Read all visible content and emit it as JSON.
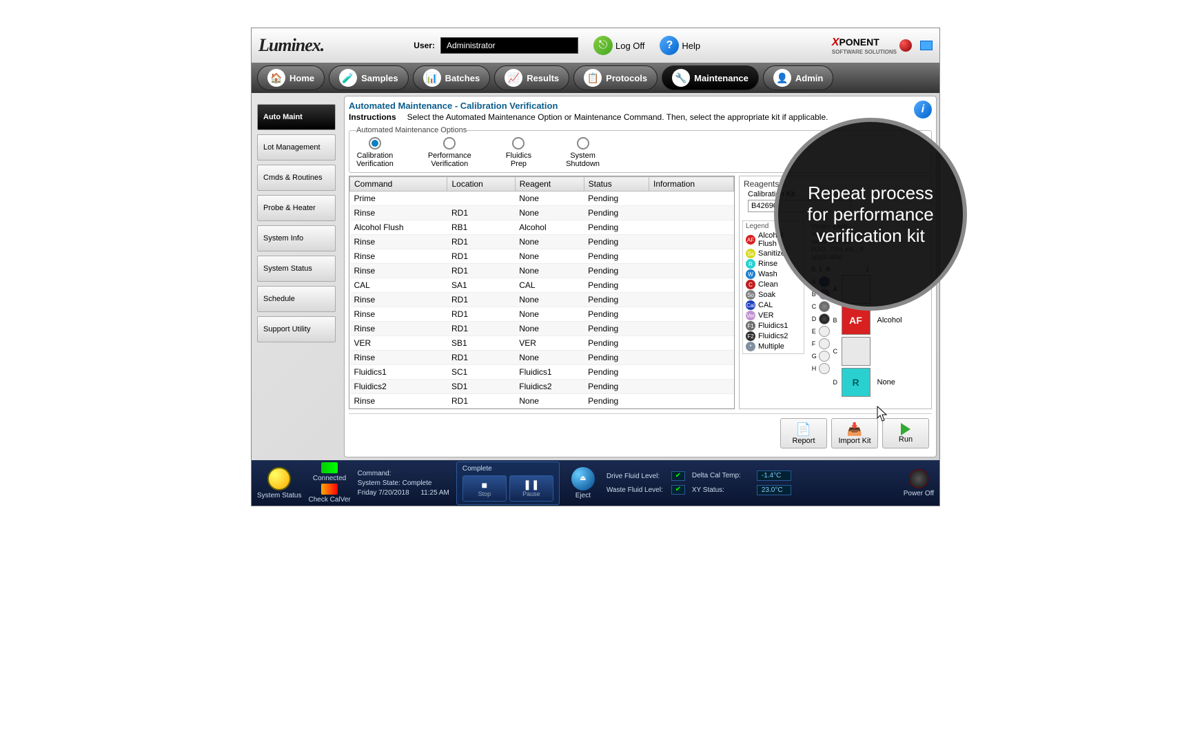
{
  "header": {
    "logo": "Luminex.",
    "user_label": "User:",
    "user_value": "Administrator",
    "logoff": "Log Off",
    "help": "Help",
    "brand_prefix": "X",
    "brand_rest": "PONENT",
    "brand_sub": "SOFTWARE SOLUTIONS"
  },
  "tabs": [
    {
      "label": "Home",
      "icon": "🏠"
    },
    {
      "label": "Samples",
      "icon": "🧪"
    },
    {
      "label": "Batches",
      "icon": "📊"
    },
    {
      "label": "Results",
      "icon": "📈"
    },
    {
      "label": "Protocols",
      "icon": "📋"
    },
    {
      "label": "Maintenance",
      "icon": "🔧",
      "active": true
    },
    {
      "label": "Admin",
      "icon": "👤"
    }
  ],
  "sidebar": [
    {
      "label": "Auto Maint",
      "active": true
    },
    {
      "label": "Lot Management"
    },
    {
      "label": "Cmds & Routines"
    },
    {
      "label": "Probe & Heater"
    },
    {
      "label": "System Info"
    },
    {
      "label": "System Status"
    },
    {
      "label": "Schedule"
    },
    {
      "label": "Support Utility"
    }
  ],
  "panel": {
    "title": "Automated Maintenance - Calibration Verification",
    "instructions_label": "Instructions",
    "instructions_text": "Select the Automated Maintenance Option or Maintenance Command. Then, select the appropriate kit if applicable.",
    "options_legend": "Automated Maintenance Options",
    "options": [
      {
        "label": "Calibration Verification",
        "selected": true
      },
      {
        "label": "Performance Verification"
      },
      {
        "label": "Fluidics Prep"
      },
      {
        "label": "System Shutdown"
      }
    ]
  },
  "table": {
    "headers": [
      "Command",
      "Location",
      "Reagent",
      "Status",
      "Information"
    ],
    "rows": [
      {
        "c": "Prime",
        "l": "",
        "r": "None",
        "s": "Pending",
        "i": ""
      },
      {
        "c": "Rinse",
        "l": "RD1",
        "r": "None",
        "s": "Pending",
        "i": ""
      },
      {
        "c": "Alcohol Flush",
        "l": "RB1",
        "r": "Alcohol",
        "s": "Pending",
        "i": ""
      },
      {
        "c": "Rinse",
        "l": "RD1",
        "r": "None",
        "s": "Pending",
        "i": ""
      },
      {
        "c": "Rinse",
        "l": "RD1",
        "r": "None",
        "s": "Pending",
        "i": ""
      },
      {
        "c": "Rinse",
        "l": "RD1",
        "r": "None",
        "s": "Pending",
        "i": ""
      },
      {
        "c": "CAL",
        "l": "SA1",
        "r": "CAL",
        "s": "Pending",
        "i": ""
      },
      {
        "c": "Rinse",
        "l": "RD1",
        "r": "None",
        "s": "Pending",
        "i": ""
      },
      {
        "c": "Rinse",
        "l": "RD1",
        "r": "None",
        "s": "Pending",
        "i": ""
      },
      {
        "c": "Rinse",
        "l": "RD1",
        "r": "None",
        "s": "Pending",
        "i": ""
      },
      {
        "c": "VER",
        "l": "SB1",
        "r": "VER",
        "s": "Pending",
        "i": ""
      },
      {
        "c": "Rinse",
        "l": "RD1",
        "r": "None",
        "s": "Pending",
        "i": ""
      },
      {
        "c": "Fluidics1",
        "l": "SC1",
        "r": "Fluidics1",
        "s": "Pending",
        "i": ""
      },
      {
        "c": "Fluidics2",
        "l": "SD1",
        "r": "Fluidics2",
        "s": "Pending",
        "i": ""
      },
      {
        "c": "Rinse",
        "l": "RD1",
        "r": "None",
        "s": "Pending",
        "i": ""
      }
    ]
  },
  "reagents": {
    "title": "Reagents",
    "kit_label": "Calibration Kit",
    "kit_value": "B42690",
    "legend_title": "Legend",
    "legend": [
      {
        "code": "AF",
        "label": "Alcohol Flush",
        "color": "#d82020"
      },
      {
        "code": "Sa",
        "label": "Sanitize",
        "color": "#d8d820"
      },
      {
        "code": "R",
        "label": "Rinse",
        "color": "#2ad0d0"
      },
      {
        "code": "W",
        "label": "Wash",
        "color": "#2080d0"
      },
      {
        "code": "C",
        "label": "Clean",
        "color": "#c02020"
      },
      {
        "code": "So",
        "label": "Soak",
        "color": "#808080"
      },
      {
        "code": "Cal",
        "label": "CAL",
        "color": "#2040c0"
      },
      {
        "code": "Ver",
        "label": "VER",
        "color": "#c090d0"
      },
      {
        "code": "F1",
        "label": "Fluidics1",
        "color": "#707070"
      },
      {
        "code": "F2",
        "label": "Fluidics2",
        "color": "#303030"
      },
      {
        "code": "*",
        "label": "Multiple",
        "color": "#8090a0"
      }
    ],
    "vortex": "Vortex each reagent into the wells with DI H2O, 70% etc., if applicable.",
    "plate_labels_left": [
      "A",
      "B",
      "C",
      "D",
      "E",
      "F",
      "G",
      "H"
    ],
    "plate_labels_big": [
      "A",
      "B",
      "C",
      "D"
    ],
    "big_right": [
      "",
      "Alcohol",
      "",
      "None"
    ]
  },
  "actions": {
    "report": "Report",
    "import": "Import Kit",
    "run": "Run"
  },
  "callout": "Repeat process for performance verification kit",
  "status": {
    "system_status": "System Status",
    "connected": "Connected",
    "check": "Check CalVer",
    "command_label": "Command:",
    "sys_state_label": "System State:",
    "sys_state_value": "Complete",
    "date": "Friday 7/20/2018",
    "time": "11:25 AM",
    "complete": "Complete",
    "stop": "Stop",
    "pause": "Pause",
    "eject": "Eject",
    "drive_label": "Drive Fluid Level:",
    "waste_label": "Waste Fluid Level:",
    "delta_label": "Delta Cal Temp:",
    "delta_value": "-1.4°C",
    "xy_label": "XY Status:",
    "xy_value": "23.0°C",
    "power": "Power Off"
  }
}
